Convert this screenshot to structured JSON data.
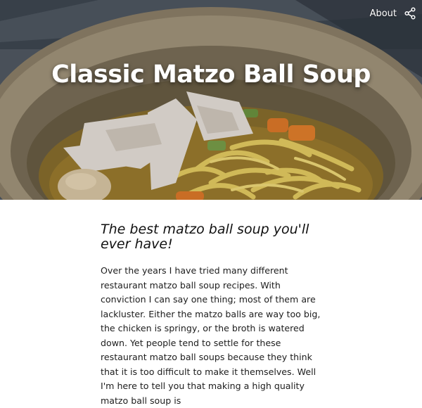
{
  "nav": {
    "about_label": "About",
    "share_icon": "share-icon"
  },
  "hero": {
    "title": "Classic Matzo Ball Soup",
    "image": "bowl of chicken noodle matzo ball soup"
  },
  "article": {
    "subtitle": "The best matzo ball soup you'll ever have!",
    "body": "Over the years I have tried many different restaurant matzo ball soup recipes. With conviction I can say one thing; most of them are lackluster. Either the matzo balls are way too big, the chicken is springy, or the broth is watered down. Yet people tend to settle for these restaurant matzo ball soups because they think that it is too difficult to make it themselves. Well I'm here to tell you that making a high quality matzo ball soup is"
  },
  "colors": {
    "title_text": "#ffffff",
    "body_text": "#1d1d1d",
    "background": "#ffffff"
  }
}
